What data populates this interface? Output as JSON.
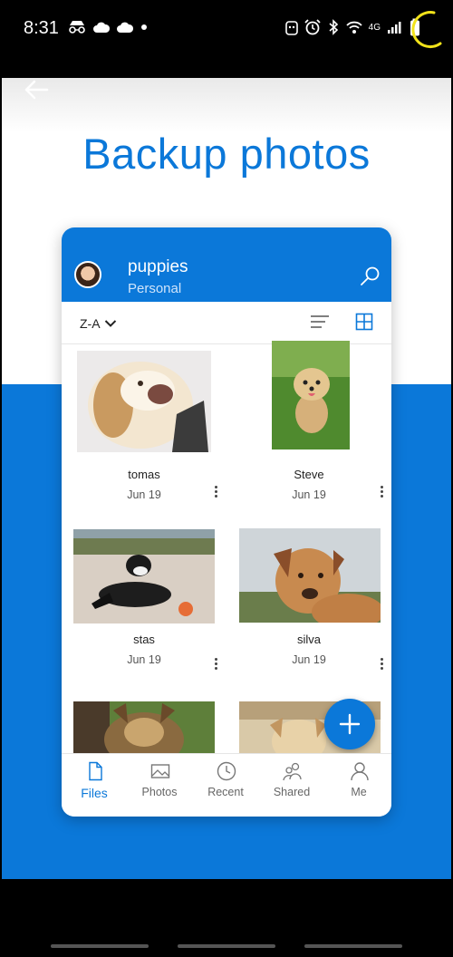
{
  "status_bar": {
    "time": "8:31",
    "network": "4G",
    "left_icons": [
      "incognito-icon",
      "cloud-icon",
      "cloud-icon",
      "dot-icon"
    ],
    "right_icons": [
      "android-icon",
      "alarm-icon",
      "bluetooth-icon",
      "wifi-icon",
      "signal-icon",
      "battery-icon"
    ]
  },
  "hero": {
    "title": "Backup photos"
  },
  "folder": {
    "name": "puppies",
    "subtitle": "Personal"
  },
  "toolbar": {
    "sort_label": "Z-A"
  },
  "files": [
    {
      "name": "tomas",
      "date": "Jun 19"
    },
    {
      "name": "Steve",
      "date": "Jun 19"
    },
    {
      "name": "stas",
      "date": "Jun 19"
    },
    {
      "name": "silva",
      "date": "Jun 19"
    },
    {
      "name": "",
      "date": ""
    },
    {
      "name": "",
      "date": ""
    }
  ],
  "nav": {
    "files": "Files",
    "photos": "Photos",
    "recent": "Recent",
    "shared": "Shared",
    "me": "Me"
  },
  "colors": {
    "accent": "#0b78d9",
    "background": "#000000"
  }
}
